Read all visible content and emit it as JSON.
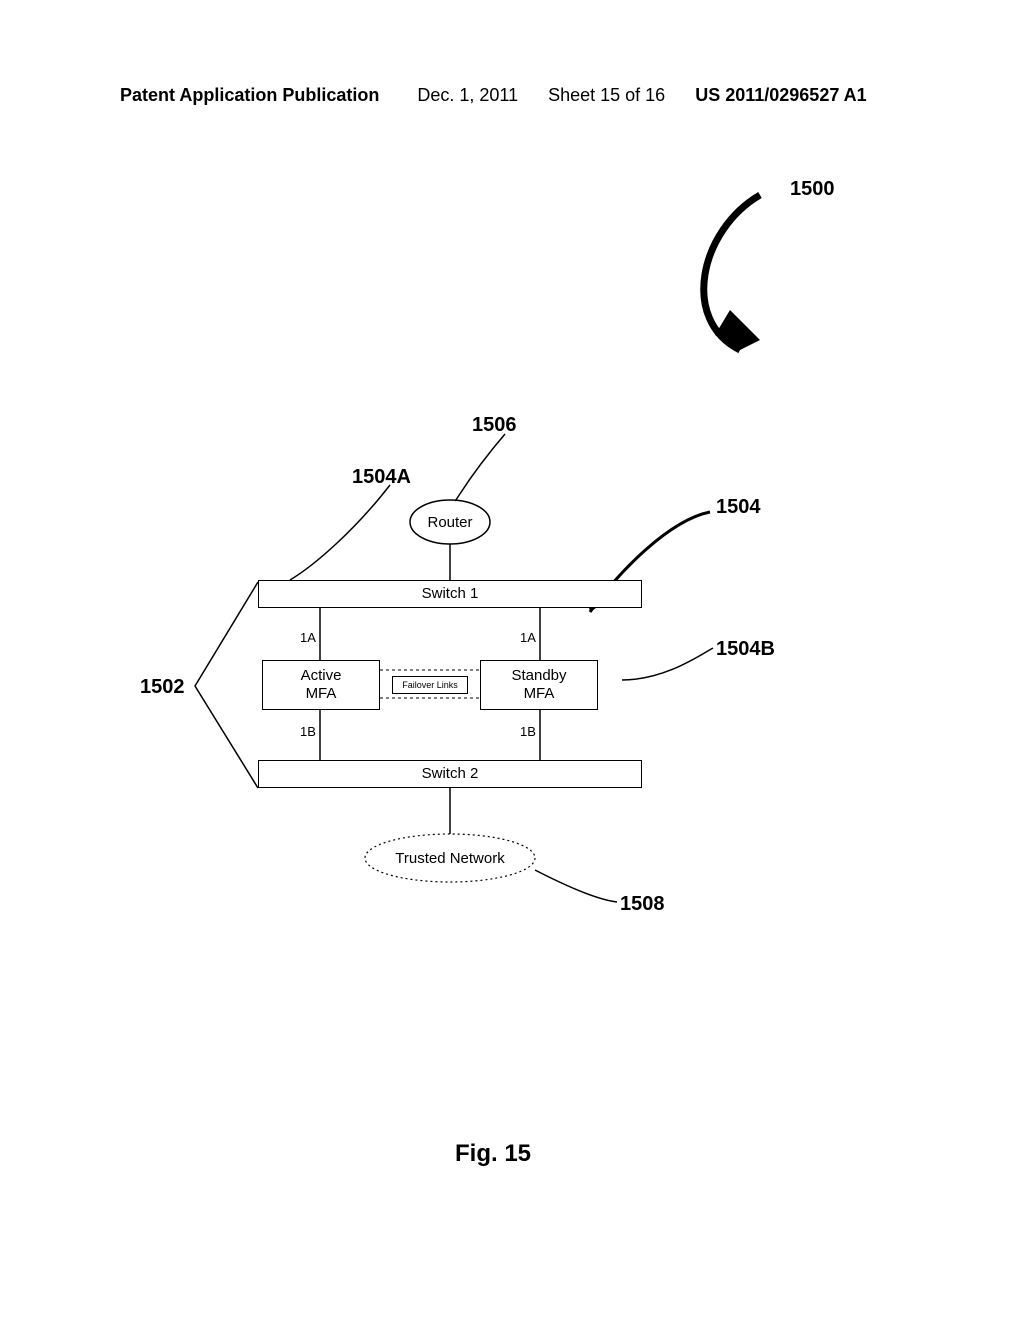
{
  "header": {
    "pub": "Patent Application Publication",
    "date": "Dec. 1, 2011",
    "sheet": "Sheet 15 of 16",
    "pubnum": "US 2011/0296527 A1"
  },
  "labels": {
    "ref1500": "1500",
    "ref1502": "1502",
    "ref1504": "1504",
    "ref1504A": "1504A",
    "ref1504B": "1504B",
    "ref1506": "1506",
    "ref1508": "1508"
  },
  "blocks": {
    "router": "Router",
    "switch1": "Switch 1",
    "switch2": "Switch 2",
    "activeMFA": "Active\nMFA",
    "standbyMFA": "Standby\nMFA",
    "failoverLinks": "Failover Links",
    "trustedNetwork": "Trusted Network",
    "port1A": "1A",
    "port1B": "1B"
  },
  "caption": "Fig. 15"
}
